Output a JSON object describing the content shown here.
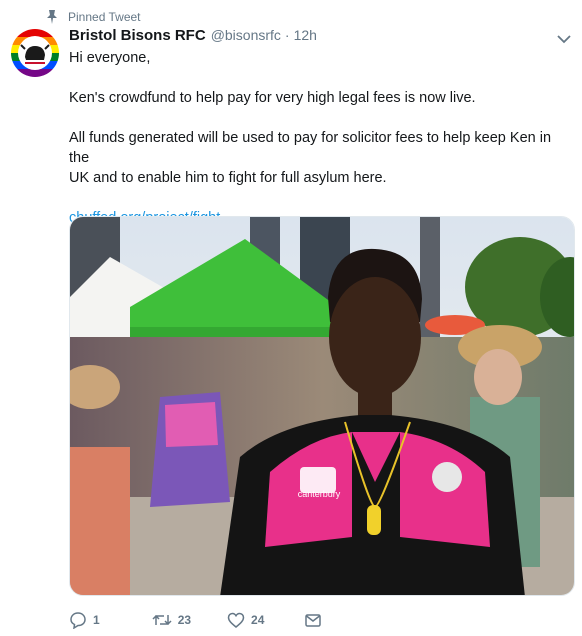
{
  "pinned_label": "Pinned Tweet",
  "author": {
    "name": "Bristol Bisons RFC",
    "handle": "@bisonsrfc",
    "separator": "·",
    "time": "12h"
  },
  "tweet": {
    "greeting": "Hi everyone,",
    "para1": "Ken's crowdfund to help pay for very high legal fees is now live.",
    "para2_line1": "All funds generated will be used to pay for solicitor fees to help keep Ken in the",
    "para2_line2": "UK and to enable him to fight for full asylum here.",
    "link": "chuffed.org/project/fight-…"
  },
  "media": {
    "shirt_brand": "canterbury"
  },
  "actions": {
    "replies": "1",
    "retweets": "23",
    "likes": "24"
  },
  "colors": {
    "link": "#1b95e0",
    "muted": "#657786",
    "pin": "#17bf63"
  },
  "icons": [
    "pin-icon",
    "chevron-down-icon",
    "reply-icon",
    "retweet-icon",
    "like-icon",
    "message-icon"
  ]
}
